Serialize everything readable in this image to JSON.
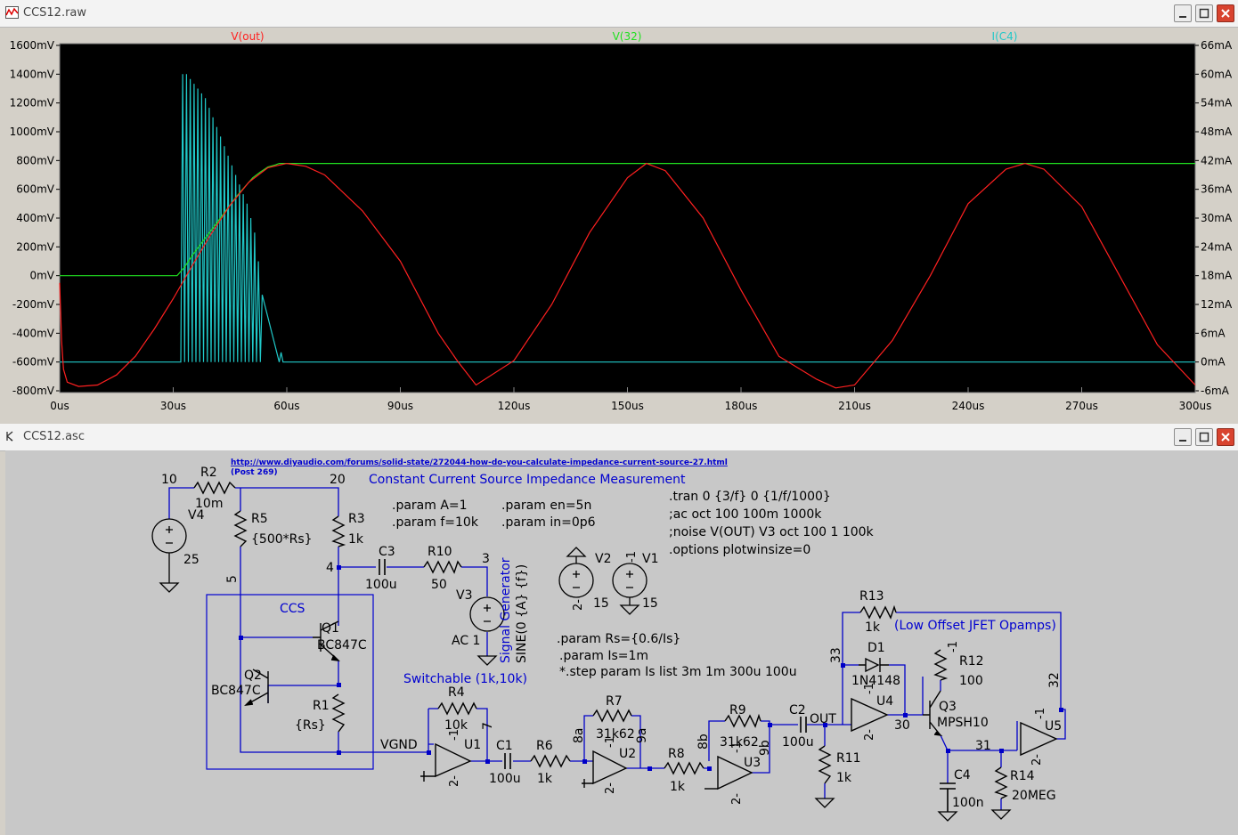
{
  "plot_window": {
    "title": "CCS12.raw",
    "traces": [
      {
        "name": "V(out)",
        "color": "#ff2020"
      },
      {
        "name": "V(32)",
        "color": "#20e020"
      },
      {
        "name": "I(C4)",
        "color": "#20c8c8"
      }
    ],
    "x_ticks": [
      "0us",
      "30us",
      "60us",
      "90us",
      "120us",
      "150us",
      "180us",
      "210us",
      "240us",
      "270us",
      "300us"
    ],
    "y_left_ticks": [
      "1600mV",
      "1400mV",
      "1200mV",
      "1000mV",
      "800mV",
      "600mV",
      "400mV",
      "200mV",
      "0mV",
      "-200mV",
      "-400mV",
      "-600mV",
      "-800mV"
    ],
    "y_right_ticks": [
      "66mA",
      "60mA",
      "54mA",
      "48mA",
      "42mA",
      "36mA",
      "30mA",
      "24mA",
      "18mA",
      "12mA",
      "6mA",
      "0mA",
      "-6mA"
    ]
  },
  "chart_data": {
    "type": "line",
    "title": "",
    "xlabel": "",
    "ylabel": "",
    "x_unit": "us",
    "xlim": [
      0,
      300
    ],
    "ylim": [
      -800,
      1600
    ],
    "y2lim": [
      -6,
      66
    ],
    "grid": false,
    "legend": "top",
    "series": [
      {
        "name": "V(out)",
        "axis": "left",
        "x": [
          0,
          0.5,
          1,
          2,
          5,
          10,
          15,
          20,
          25,
          30,
          35,
          40,
          45,
          50,
          55,
          60,
          65,
          70,
          80,
          90,
          100,
          105,
          110,
          120,
          130,
          140,
          150,
          155,
          160,
          170,
          180,
          190,
          200,
          205,
          210,
          220,
          230,
          240,
          250,
          255,
          260,
          270,
          280,
          290,
          300
        ],
        "y": [
          -50,
          -450,
          -650,
          -740,
          -770,
          -760,
          -690,
          -560,
          -370,
          -160,
          70,
          290,
          490,
          650,
          750,
          780,
          760,
          700,
          450,
          100,
          -400,
          -590,
          -760,
          -590,
          -200,
          300,
          680,
          780,
          730,
          400,
          -100,
          -560,
          -720,
          -780,
          -760,
          -450,
          0,
          500,
          740,
          780,
          740,
          480,
          0,
          -480,
          -760
        ]
      },
      {
        "name": "V(32)",
        "axis": "left",
        "x": [
          0,
          31,
          33,
          35,
          37,
          39,
          41,
          43,
          45,
          47,
          49,
          51,
          53,
          55,
          57,
          58,
          300
        ],
        "y": [
          0,
          0,
          60,
          140,
          210,
          280,
          350,
          420,
          490,
          560,
          620,
          680,
          720,
          755,
          770,
          780,
          780
        ]
      },
      {
        "name": "I(C4)",
        "axis": "right",
        "x": [
          0,
          32,
          32.5,
          33,
          33.5,
          34,
          34.5,
          35,
          35.5,
          36,
          36.5,
          37,
          37.5,
          38,
          38.5,
          39,
          39.5,
          40,
          40.5,
          41,
          41.5,
          42,
          42.5,
          43,
          43.5,
          44,
          44.5,
          45,
          45.5,
          46,
          46.5,
          47,
          47.5,
          48,
          48.5,
          49,
          49.5,
          50,
          50.5,
          51,
          51.5,
          52,
          52.5,
          53,
          53.5,
          58,
          58.5,
          59,
          300
        ],
        "y": [
          0,
          0,
          60,
          0,
          60,
          0,
          59,
          0,
          58,
          0,
          57,
          0,
          56,
          0,
          55,
          0,
          53,
          0,
          51,
          0,
          49,
          0,
          47,
          0,
          45,
          0,
          43,
          0,
          41,
          0,
          39,
          0,
          37,
          0,
          35,
          0,
          33,
          0,
          30,
          0,
          27,
          0,
          21,
          0,
          14,
          0,
          2,
          0,
          0
        ]
      }
    ]
  },
  "schematic_window": {
    "title": "CCS12.asc",
    "link": "http://www.diyaudio.com/forums/solid-state/272044-how-do-you-calculate-impedance-current-source-27.html",
    "post": "(Post 269)",
    "heading": "Constant Current Source Impedance Measurement",
    "params_left": [
      ".param A=1",
      ".param f=10k"
    ],
    "params_right": [
      ".param en=5n",
      ".param in=0p6"
    ],
    "directives": [
      ".tran 0 {3/f} 0 {1/f/1000}",
      ";ac oct 100 100m 1000k",
      ";noise V(OUT) V3 oct 100 1 100k",
      ".options plotwinsize=0"
    ],
    "rs_params": [
      ".param Rs={0.6/Is}",
      ".param Is=1m",
      "*.step param Is list 3m 1m 300u 100u"
    ],
    "ccs_label": "CCS",
    "switchable_label": "Switchable (1k,10k)",
    "jfet_label": "(Low Offset JFET Opamps)",
    "signal_generator": "Signal Generator",
    "sine": "SINE(0 {A} {f})",
    "components": {
      "R2": "R2",
      "R2_val": "10m",
      "R5": "R5",
      "R5_val": "{500*Rs}",
      "R3": "R3",
      "R3_val": "1k",
      "R1": "R1",
      "R1_val": "{Rs}",
      "R4": "R4",
      "R4_val": "10k",
      "R6": "R6",
      "R6_val": "1k",
      "R7": "R7",
      "R7_val": "31k62",
      "R8": "R8",
      "R8_val": "1k",
      "R9": "R9",
      "R9_val": "31k62",
      "R10": "R10",
      "R10_val": "50",
      "R11": "R11",
      "R11_val": "1k",
      "R12": "R12",
      "R12_val": "100",
      "R13": "R13",
      "R13_val": "1k",
      "R14": "R14",
      "R14_val": "20MEG",
      "C1": "C1",
      "C1_val": "100u",
      "C2": "C2",
      "C2_val": "100u",
      "C3": "C3",
      "C3_val": "100u",
      "C4": "C4",
      "C4_val": "100n",
      "V1": "V1",
      "V1_val": "15",
      "V2": "V2",
      "V2_val": "15",
      "V3": "V3",
      "V3_val": "AC 1",
      "V4": "V4",
      "V4_val": "25",
      "Q1": "Q1",
      "Q1_val": "BC847C",
      "Q2": "Q2",
      "Q2_val": "BC847C",
      "Q3": "Q3",
      "Q3_val": "MPSH10",
      "D1": "D1",
      "D1_val": "1N4148",
      "U1": "U1",
      "U2": "U2",
      "U3": "U3",
      "U4": "U4",
      "U5": "U5"
    },
    "nets": {
      "n10": "10",
      "n20": "20",
      "n4": "4",
      "n3": "3",
      "n5": "5",
      "n7": "7",
      "n8a": "8a",
      "n9a": "9a",
      "n8b": "8b",
      "n9b": "9b",
      "n33": "33",
      "n30": "30",
      "n31": "31",
      "n32": "32",
      "vgnd": "VGND",
      "out": "OUT"
    },
    "pins": {
      "m1": "-1",
      "p2": "2-"
    }
  }
}
